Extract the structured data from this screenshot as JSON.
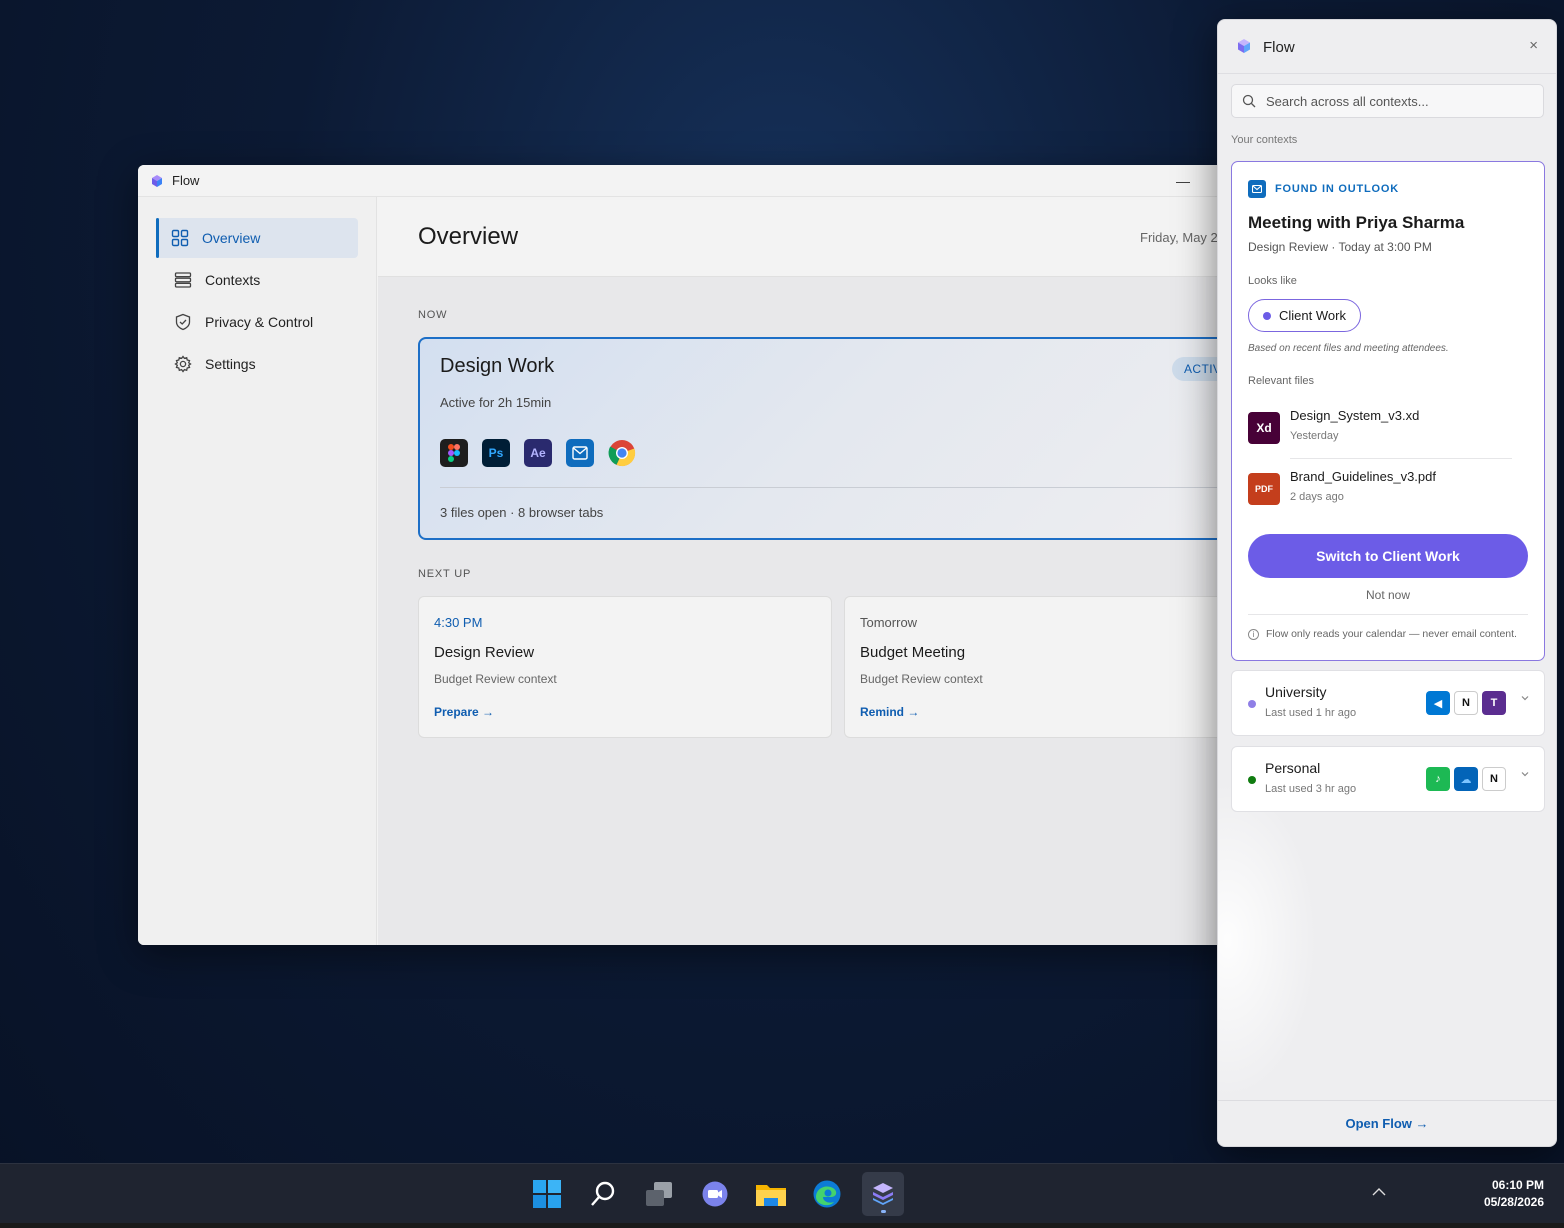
{
  "window": {
    "title": "Flow",
    "minimize_glyph": "—"
  },
  "sidebar": {
    "items": [
      {
        "label": "Overview",
        "icon": "grid-icon",
        "active": true
      },
      {
        "label": "Contexts",
        "icon": "stack-icon",
        "active": false
      },
      {
        "label": "Privacy & Control",
        "icon": "shield-icon",
        "active": false
      },
      {
        "label": "Settings",
        "icon": "gear-icon",
        "active": false
      }
    ]
  },
  "main": {
    "title": "Overview",
    "date": "Friday, May 2",
    "now_label": "NOW",
    "now": {
      "title": "Design Work",
      "subtitle": "Active for 2h 15min",
      "badge": "ACTIV",
      "apps": [
        {
          "name": "figma-icon",
          "text": ""
        },
        {
          "name": "photoshop-icon",
          "text": "Ps"
        },
        {
          "name": "after-effects-icon",
          "text": "Ae"
        },
        {
          "name": "outlook-icon",
          "text": ""
        },
        {
          "name": "chrome-icon",
          "text": ""
        }
      ],
      "footer": "3 files open · 8 browser tabs"
    },
    "next_label": "NEXT UP",
    "next": [
      {
        "time": "4:30 PM",
        "title": "Design Review",
        "context": "Budget Review context",
        "action": "Prepare →",
        "time_color": "#0f5db0"
      },
      {
        "time": "Tomorrow",
        "title": "Budget Meeting",
        "context": "Budget Review context",
        "action": "Remind →",
        "time_color": "#555555"
      }
    ]
  },
  "panel": {
    "title": "Flow",
    "close_glyph": "×",
    "search_placeholder": "Search across all contexts...",
    "contexts_label": "Your contexts",
    "found": {
      "source": "FOUND IN OUTLOOK",
      "title": "Meeting with Priya Sharma",
      "subtitle": "Design Review · Today at 3:00 PM",
      "looks_like_label": "Looks like",
      "chip": "Client Work",
      "note": "Based on recent files and meeting attendees.",
      "files_label": "Relevant files",
      "files": [
        {
          "name": "Design_System_v3.xd",
          "time": "Yesterday",
          "badge": "Xd",
          "color": "#470137"
        },
        {
          "name": "Brand_Guidelines_v3.pdf",
          "time": "2 days ago",
          "badge": "PDF",
          "color": "#c43e1c"
        }
      ],
      "primary_button": "Switch to Client Work",
      "secondary_button": "Not now",
      "privacy_note": "Flow only reads your calendar — never email content.",
      "info_glyph": "i"
    },
    "contexts": [
      {
        "name": "University",
        "last_used": "Last used 1 hr ago",
        "dot": "#8f7fe6",
        "apps": [
          {
            "t": "◀",
            "bg": "#0078d4",
            "fg": "#ffffff",
            "icon": "vscode-icon"
          },
          {
            "t": "N",
            "bg": "#ffffff",
            "fg": "#111111",
            "icon": "notion-icon"
          },
          {
            "t": "T",
            "bg": "#5b2d90",
            "fg": "#ffffff",
            "icon": "teams-icon"
          }
        ]
      },
      {
        "name": "Personal",
        "last_used": "Last used 3 hr ago",
        "dot": "#107c10",
        "apps": [
          {
            "t": "♪",
            "bg": "#1db954",
            "fg": "#ffffff",
            "icon": "spotify-icon"
          },
          {
            "t": "☁",
            "bg": "#0364b8",
            "fg": "#ffffff",
            "icon": "onedrive-icon"
          },
          {
            "t": "N",
            "bg": "#ffffff",
            "fg": "#111111",
            "icon": "notion-icon"
          }
        ]
      }
    ],
    "footer": "Open Flow →"
  },
  "taskbar": {
    "icons": [
      "windows-start-icon",
      "search-icon",
      "task-view-icon",
      "teams-chat-icon",
      "file-explorer-icon",
      "edge-icon",
      "flow-icon"
    ],
    "time": "06:10 PM",
    "date": "05/28/2026"
  }
}
